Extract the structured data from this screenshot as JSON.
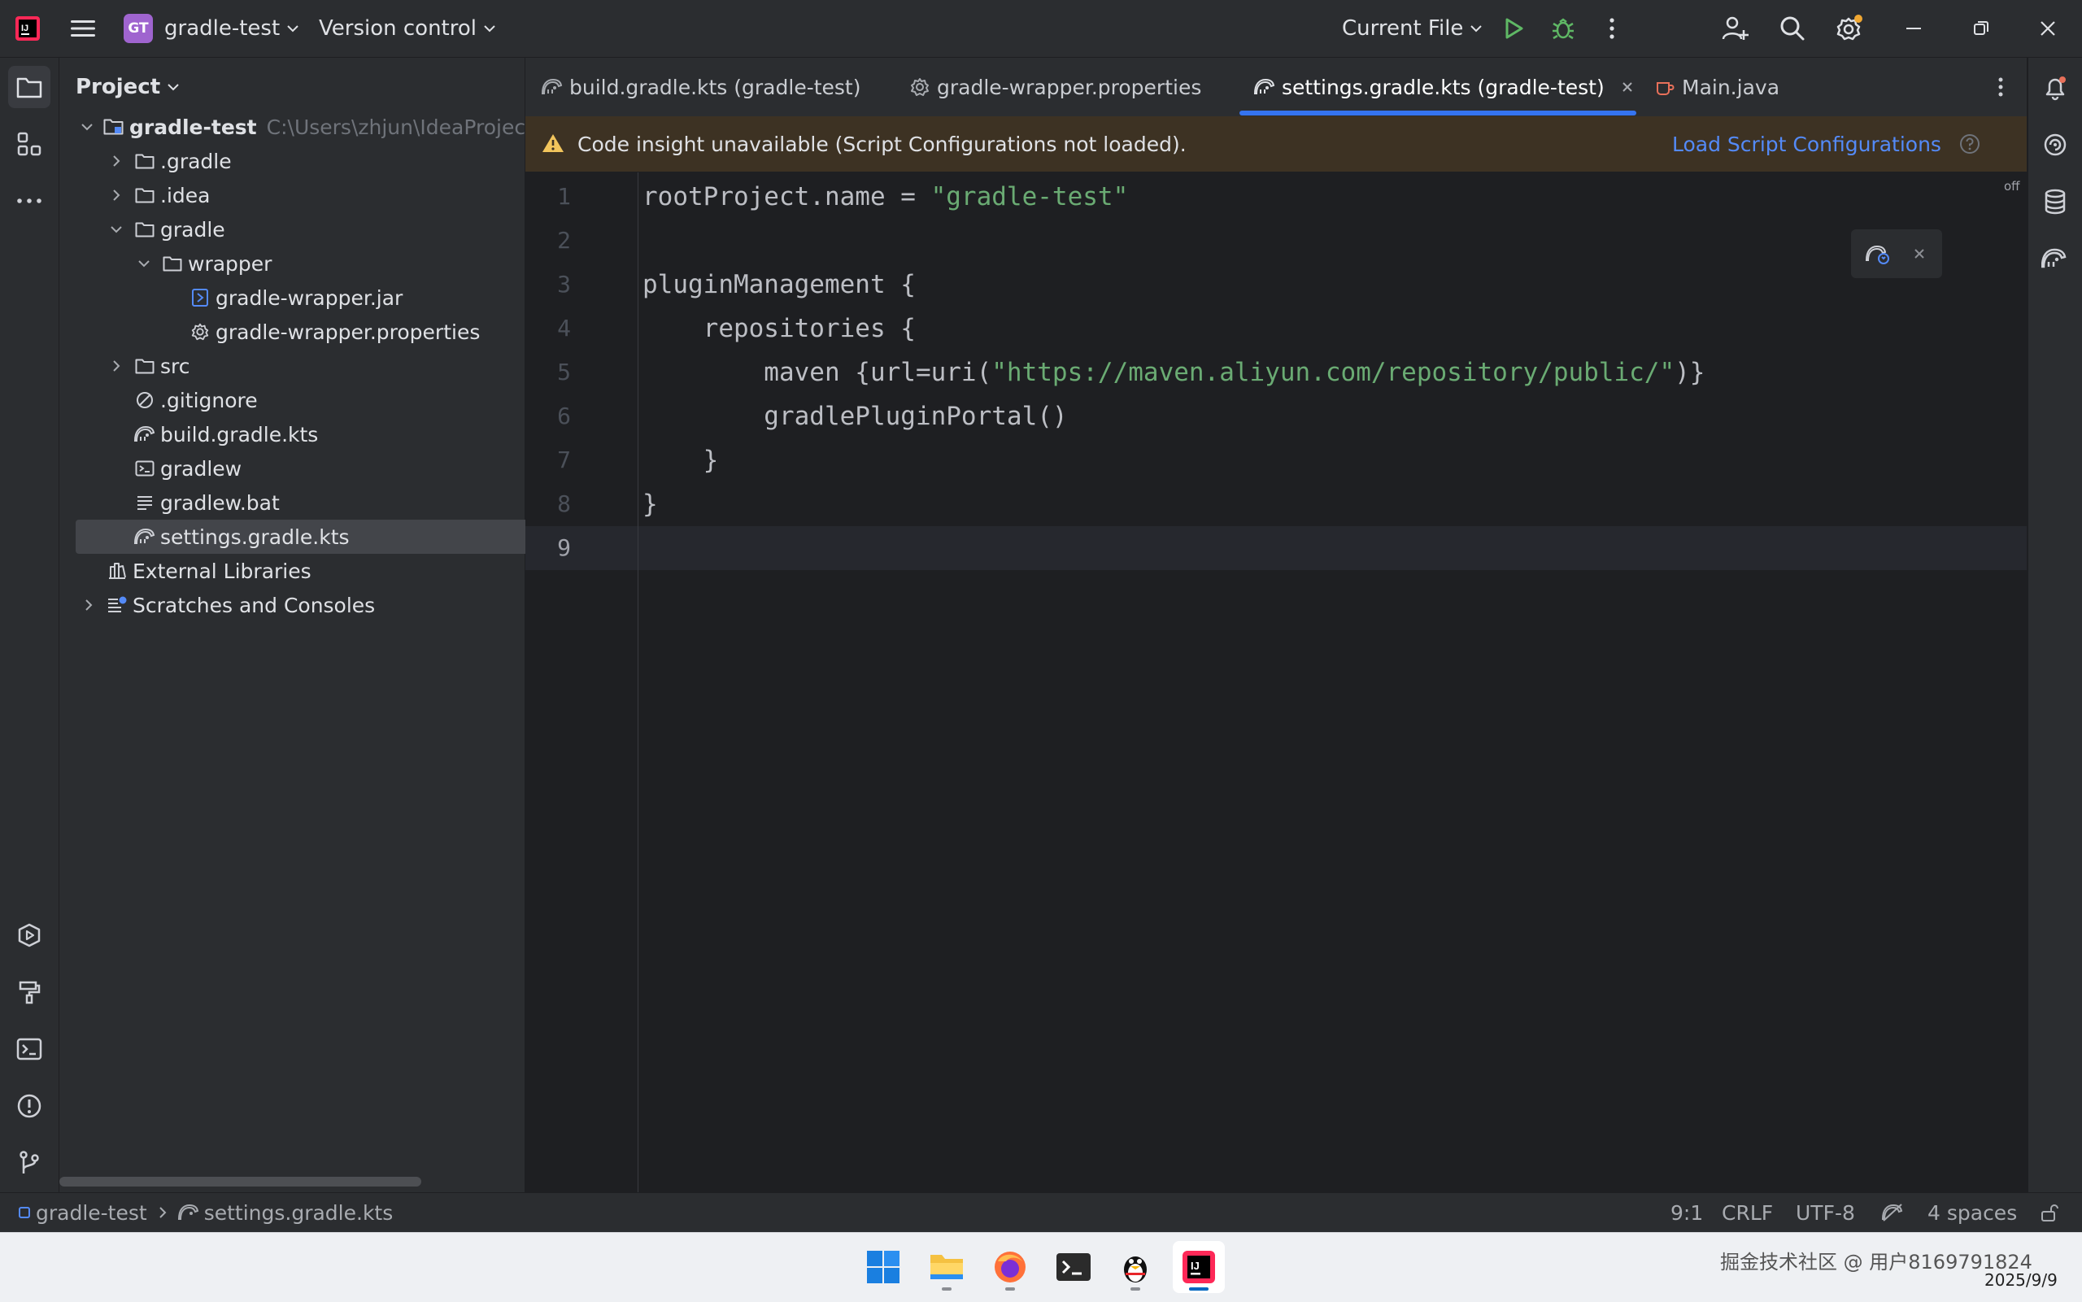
{
  "titlebar": {
    "project_badge": "GT",
    "project_name": "gradle-test",
    "version_control": "Version control",
    "run_config": "Current File"
  },
  "project_panel": {
    "title": "Project",
    "tree": [
      {
        "label": "gradle-test",
        "hint": "C:\\Users\\zhjun\\IdeaProjects\\",
        "indent": 0,
        "expanded": true,
        "icon": "module-folder-icon"
      },
      {
        "label": ".gradle",
        "indent": 1,
        "expanded": false,
        "icon": "folder-icon"
      },
      {
        "label": ".idea",
        "indent": 1,
        "expanded": false,
        "icon": "folder-icon"
      },
      {
        "label": "gradle",
        "indent": 1,
        "expanded": true,
        "icon": "folder-icon"
      },
      {
        "label": "wrapper",
        "indent": 2,
        "expanded": true,
        "icon": "folder-icon"
      },
      {
        "label": "gradle-wrapper.jar",
        "indent": 3,
        "icon": "jar-file-icon"
      },
      {
        "label": "gradle-wrapper.properties",
        "indent": 3,
        "icon": "properties-file-icon"
      },
      {
        "label": "src",
        "indent": 1,
        "expanded": false,
        "icon": "folder-icon"
      },
      {
        "label": ".gitignore",
        "indent": 1,
        "icon": "ignore-file-icon"
      },
      {
        "label": "build.gradle.kts",
        "indent": 1,
        "icon": "gradle-file-icon"
      },
      {
        "label": "gradlew",
        "indent": 1,
        "icon": "shell-file-icon"
      },
      {
        "label": "gradlew.bat",
        "indent": 1,
        "icon": "text-file-icon"
      },
      {
        "label": "settings.gradle.kts",
        "indent": 1,
        "icon": "gradle-file-icon",
        "selected": true
      },
      {
        "label": "External Libraries",
        "indent": 0,
        "icon": "library-icon"
      },
      {
        "label": "Scratches and Consoles",
        "indent": 0,
        "expanded": false,
        "icon": "scratches-icon"
      }
    ]
  },
  "tabs": [
    {
      "label": "build.gradle.kts (gradle-test)",
      "icon": "gradle-file-icon"
    },
    {
      "label": "gradle-wrapper.properties",
      "icon": "properties-file-icon"
    },
    {
      "label": "settings.gradle.kts (gradle-test)",
      "icon": "gradle-file-icon",
      "active": true
    },
    {
      "label": "Main.java",
      "icon": "java-file-icon"
    }
  ],
  "banner": {
    "message": "Code insight unavailable (Script Configurations not loaded).",
    "action": "Load Script Configurations"
  },
  "editor": {
    "inspection_label": "off",
    "line_numbers": [
      "1",
      "2",
      "3",
      "4",
      "5",
      "6",
      "7",
      "8",
      "9"
    ],
    "lines": [
      {
        "plain": "rootProject.name = ",
        "string": "\"gradle-test\"",
        "after": ""
      },
      {
        "plain": "",
        "string": "",
        "after": ""
      },
      {
        "plain": "pluginManagement {",
        "string": "",
        "after": ""
      },
      {
        "plain": "    repositories {",
        "string": "",
        "after": ""
      },
      {
        "plain": "        maven {url=uri(",
        "string": "\"https://maven.aliyun.com/repository/public/\"",
        "after": ")}"
      },
      {
        "plain": "        gradlePluginPortal()",
        "string": "",
        "after": ""
      },
      {
        "plain": "    }",
        "string": "",
        "after": ""
      },
      {
        "plain": "}",
        "string": "",
        "after": ""
      },
      {
        "plain": "",
        "string": "",
        "after": ""
      }
    ]
  },
  "statusbar": {
    "breadcrumb_project": "gradle-test",
    "breadcrumb_file": "settings.gradle.kts",
    "position": "9:1",
    "line_ending": "CRLF",
    "encoding": "UTF-8",
    "indent": "4 spaces"
  },
  "taskbar": {
    "tray_text": "掘金技术社区 @ 用户8169791824",
    "date": "2025/9/9"
  },
  "colors": {
    "accent": "#3574f0",
    "string": "#6aab73",
    "banner_bg": "#3d3223",
    "run_green": "#5fb865"
  }
}
